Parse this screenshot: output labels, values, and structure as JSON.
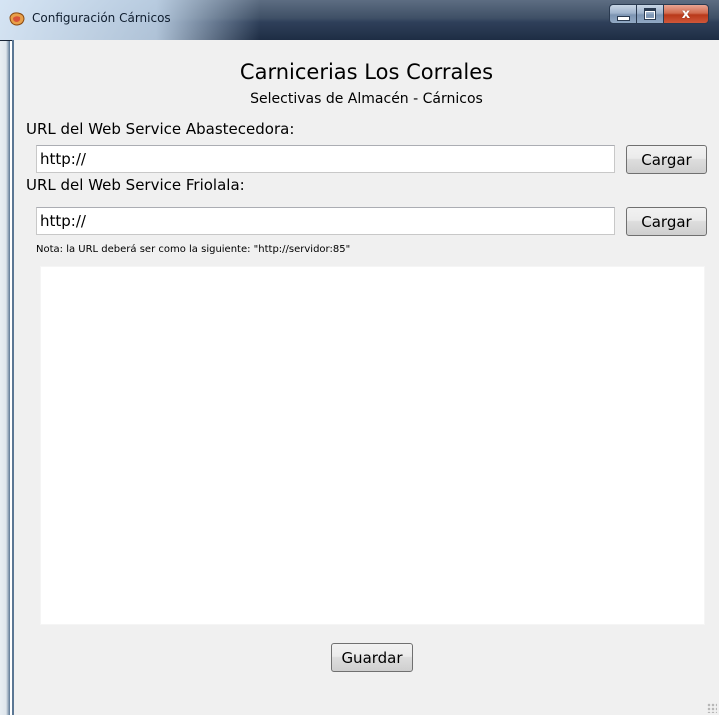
{
  "window": {
    "title": "Configuración Cárnicos",
    "app_icon": "meat-app-icon",
    "controls": {
      "minimize_icon": "minimize-icon",
      "maximize_icon": "maximize-icon",
      "close_glyph": "x"
    }
  },
  "header": {
    "title": "Carnicerias Los Corrales",
    "subtitle": "Selectivas de Almacén - Cárnicos"
  },
  "form": {
    "abastecedora": {
      "label": "URL del Web Service Abastecedora:",
      "value": "http://",
      "button_label": "Cargar"
    },
    "friolala": {
      "label": "URL del Web Service Friolala:",
      "value": "http://",
      "button_label": "Cargar"
    },
    "note": "Nota: la URL deberá ser como la siguiente: \"http://servidor:85\""
  },
  "footer": {
    "save_label": "Guardar"
  },
  "colors": {
    "titlebar_dark": "#1e2d44",
    "client_bg": "#f0f0f0",
    "close_button": "#c94a2a"
  }
}
